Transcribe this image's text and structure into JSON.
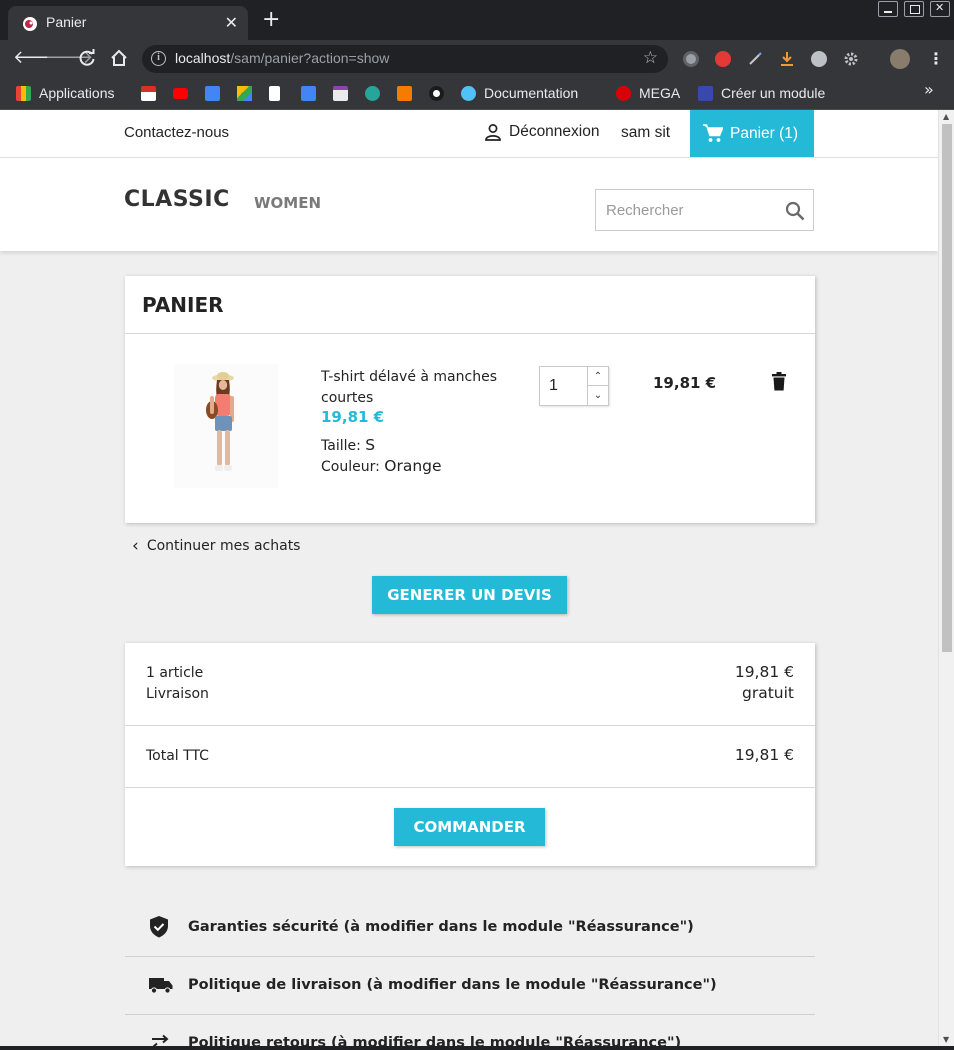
{
  "browser": {
    "tab_title": "Panier",
    "new_tab_label": "+",
    "url_host": "localhost",
    "url_path": "/sam/panier?action=show",
    "bookmarks": {
      "applications": "Applications",
      "documentation": "Documentation",
      "mega": "MEGA",
      "creer_module": "Créer un module"
    },
    "more_label": "»"
  },
  "topnav": {
    "contact": "Contactez-nous",
    "logout": "Déconnexion",
    "username": "sam sit",
    "cart": "Panier (1)"
  },
  "header": {
    "logo": "CLASSIC",
    "menu_women": "WOMEN",
    "search_placeholder": "Rechercher"
  },
  "cart": {
    "title": "PANIER",
    "product": {
      "name": "T-shirt délavé à manches courtes",
      "price": "19,81 €",
      "size_label": "Taille:",
      "size_value": "S",
      "color_label": "Couleur:",
      "color_value": "Orange",
      "quantity": "1",
      "line_total": "19,81 €"
    },
    "continue": "Continuer mes achats",
    "quote_button": "GENERER UN DEVIS"
  },
  "summary": {
    "items_label": "1 article",
    "items_value": "19,81 €",
    "shipping_label": "Livraison",
    "shipping_value": "gratuit",
    "total_label": "Total TTC",
    "total_value": "19,81 €",
    "order_button": "COMMANDER"
  },
  "reassurance": {
    "security": "Garanties sécurité (à modifier dans le module \"Réassurance\")",
    "delivery": "Politique de livraison (à modifier dans le module \"Réassurance\")",
    "returns": "Politique retours (à modifier dans le module \"Réassurance\")"
  },
  "colors": {
    "accent": "#24b9d7",
    "text": "#232323",
    "page_bg": "#efefef"
  }
}
